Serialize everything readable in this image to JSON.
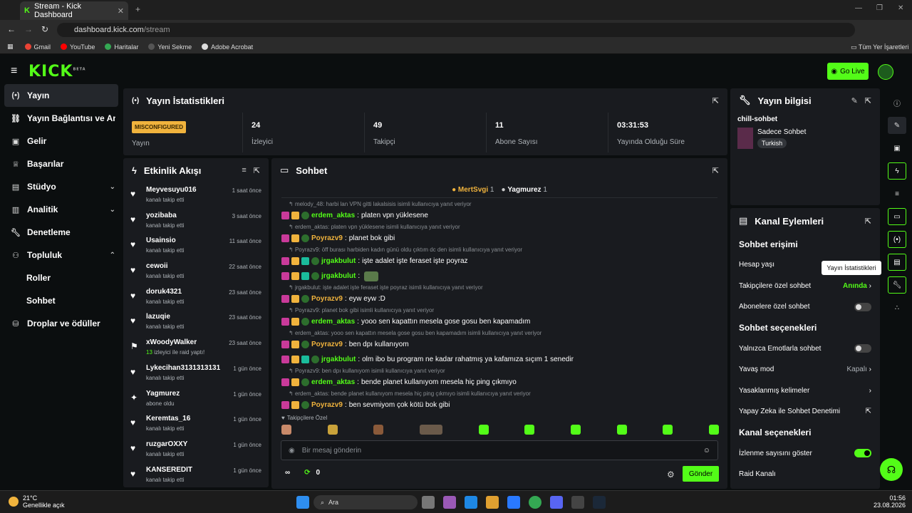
{
  "browser": {
    "tab_title": "Stream - Kick Dashboard",
    "url_host": "dashboard.kick.com",
    "url_path": "/stream",
    "bookmarks": [
      "Gmail",
      "YouTube",
      "Haritalar",
      "Yeni Sekme",
      "Adobe Acrobat"
    ],
    "bookmarks_right": "Tüm Yer İşaretleri"
  },
  "header": {
    "logo": "KICK",
    "logo_sup": "BETA",
    "go_live": "Go Live"
  },
  "sidebar": [
    {
      "label": "Yayın",
      "icon": "broadcast-icon"
    },
    {
      "label": "Yayın Bağlantısı ve Anahtarı",
      "icon": "link-icon"
    },
    {
      "label": "Gelir",
      "icon": "money-icon"
    },
    {
      "label": "Başarılar",
      "icon": "trophy-icon"
    },
    {
      "label": "Stüdyo",
      "icon": "studio-icon"
    },
    {
      "label": "Analitik",
      "icon": "chart-icon"
    },
    {
      "label": "Denetleme",
      "icon": "wrench-icon"
    },
    {
      "label": "Topluluk",
      "icon": "people-icon"
    },
    {
      "label": "Roller"
    },
    {
      "label": "Sohbet"
    },
    {
      "label": "Droplar ve ödüller",
      "icon": "gift-icon"
    }
  ],
  "stats": {
    "title": "Yayın İstatistikleri",
    "badge": "MISCONFIGURED",
    "items": [
      {
        "value": "",
        "label": "Yayın"
      },
      {
        "value": "24",
        "label": "İzleyici"
      },
      {
        "value": "49",
        "label": "Takipçi"
      },
      {
        "value": "11",
        "label": "Abone Sayısı"
      },
      {
        "value": "03:31:53",
        "label": "Yayında Olduğu Süre"
      }
    ]
  },
  "events": {
    "title": "Etkinlik Akışı",
    "items": [
      {
        "name": "Meyvesuyu016",
        "sub": "kanalı takip etti",
        "time": "1 saat önce"
      },
      {
        "name": "yozibaba",
        "sub": "kanalı takip etti",
        "time": "3 saat önce"
      },
      {
        "name": "Usainsio",
        "sub": "kanalı takip etti",
        "time": "11 saat önce"
      },
      {
        "name": "cewoii",
        "sub": "kanalı takip etti",
        "time": "22 saat önce"
      },
      {
        "name": "doruk4321",
        "sub": "kanalı takip etti",
        "time": "23 saat önce"
      },
      {
        "name": "lazuqie",
        "sub": "kanalı takip etti",
        "time": "23 saat önce"
      },
      {
        "name": "xWoodyWalker",
        "sub": "izleyici ile raid yaptı!",
        "count": "13",
        "time": "23 saat önce"
      },
      {
        "name": "Lykecihan3131313131",
        "sub": "kanalı takip etti",
        "time": "1 gün önce"
      },
      {
        "name": "Yagmurez",
        "sub": "abone oldu",
        "time": "1 gün önce"
      },
      {
        "name": "Keremtas_16",
        "sub": "kanalı takip etti",
        "time": "1 gün önce"
      },
      {
        "name": "ruzgarOXXY",
        "sub": "kanalı takip etti",
        "time": "1 gün önce"
      },
      {
        "name": "KANSEREDIT",
        "sub": "kanalı takip etti",
        "time": "1 gün önce"
      }
    ]
  },
  "chat": {
    "title": "Sohbet",
    "top1": "MertSvgi",
    "top1_n": "1",
    "top2": "Yagmurez",
    "top2_n": "1",
    "messages": [
      {
        "reply": "melody_48: harbi lan VPN gitti lakalsisis isimli kullanıcıya yanıt veriyor",
        "user": "erdem_aktas",
        "color": "#53fc18",
        "text": "platen vpn yüklesene"
      },
      {
        "reply": "erdem_aktas: platen vpn yüklesene isimli kullanıcıya yanıt veriyor",
        "user": "Poyrazv9",
        "color": "#f0b33d",
        "text": "planet bok gibi"
      },
      {
        "reply": "Poyrazv9: öff burası harbiden kadın günü oldu çıktım dc den isimli kullanıcıya yanıt veriyor",
        "user": "jrgakbulut",
        "color": "#53fc18",
        "text": "işte adalet işte feraset işte poyraz"
      },
      {
        "reply": "",
        "user": "jrgakbulut",
        "color": "#53fc18",
        "text": ""
      },
      {
        "reply": "jrgakbulut: işte adalet işte feraset işte poyraz isimli kullanıcıya yanıt veriyor",
        "user": "Poyrazv9",
        "color": "#f0b33d",
        "text": "eyw eyw :D"
      },
      {
        "reply": "Poyrazv9: planet bok gibi isimli kullanıcıya yanıt veriyor",
        "user": "erdem_aktas",
        "color": "#53fc18",
        "text": "yooo sen kapattın mesela gose gosu ben kapamadım"
      },
      {
        "reply": "erdem_aktas: yooo sen kapattın mesela gose gosu ben kapamadım isimli kullanıcıya yanıt veriyor",
        "user": "Poyrazv9",
        "color": "#f0b33d",
        "text": "ben dpı kullanıyom"
      },
      {
        "reply": "",
        "user": "jrgakbulut",
        "color": "#53fc18",
        "text": "olm ibo bu program ne kadar rahatmış ya kafamıza sıçım 1 senedir"
      },
      {
        "reply": "Poyrazv9: ben dpı kullanıyom isimli kullanıcıya yanıt veriyor",
        "user": "erdem_aktas",
        "color": "#53fc18",
        "text": "bende planet kullanıyom mesela hiç ping çıkmıyo"
      },
      {
        "reply": "erdem_aktas: bende planet kullanıyom mesela hiç ping çıkmıyo isimli kullanıcıya yanıt veriyor",
        "user": "Poyrazv9",
        "color": "#f0b33d",
        "text": "ben sevmiyom çok kötü bok gibi"
      }
    ],
    "emote_label": "Takipçilere Özel",
    "placeholder": "Bir mesaj gönderin",
    "points": "0",
    "send": "Gönder"
  },
  "info": {
    "title": "Yayın bilgisi",
    "stream_title": "chill-sohbet",
    "category": "Sadece Sohbet",
    "language": "Turkish"
  },
  "actions": {
    "title": "Kanal Eylemleri",
    "sec1": "Sohbet erişimi",
    "account_age": "Hesap yaşı",
    "followers_only": "Takipçilere özel sohbet",
    "followers_only_val": "Anında",
    "subs_only": "Abonelere özel sohbet",
    "sec2": "Sohbet seçenekleri",
    "emote_only": "Yalnızca Emotlarla sohbet",
    "slow": "Yavaş mod",
    "slow_val": "Kapalı",
    "banned": "Yasaklanmış kelimeler",
    "ai": "Yapay Zeka ile Sohbet Denetimi",
    "sec3": "Kanal seçenekleri",
    "viewer_count": "İzlenme sayısını göster",
    "raid": "Raid Kanalı"
  },
  "tooltip": "Yayın İstatistikleri",
  "taskbar": {
    "temp": "21°C",
    "weather": "Genellikle açık",
    "search": "Ara",
    "time": "01:56",
    "date": "23.08.2026"
  }
}
